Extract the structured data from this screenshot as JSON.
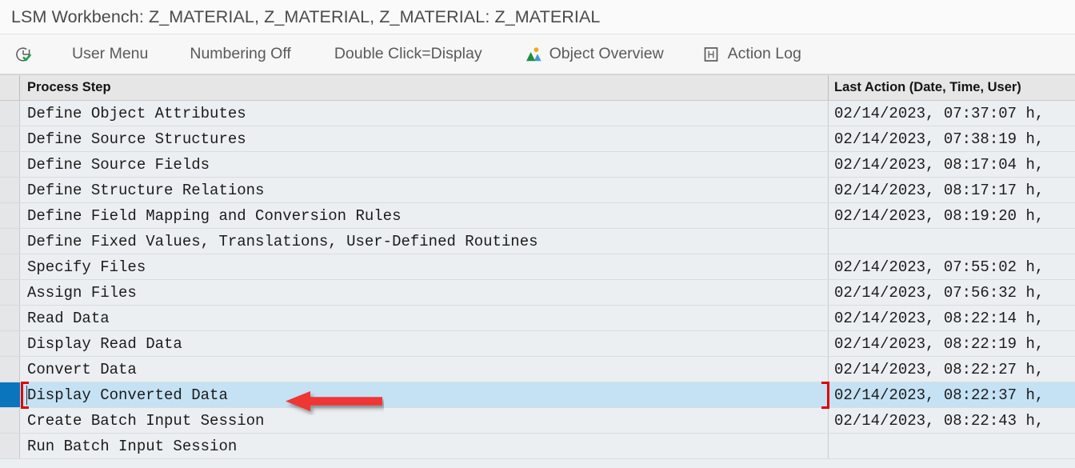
{
  "window": {
    "title": "LSM Workbench: Z_MATERIAL, Z_MATERIAL, Z_MATERIAL: Z_MATERIAL"
  },
  "toolbar": {
    "items": [
      {
        "label": "",
        "icon": "clock-check-icon"
      },
      {
        "label": "User Menu",
        "icon": ""
      },
      {
        "label": "Numbering Off",
        "icon": ""
      },
      {
        "label": "Double Click=Display",
        "icon": ""
      },
      {
        "label": "Object Overview",
        "icon": "image-overview-icon"
      },
      {
        "label": "Action Log",
        "icon": "h-box-icon"
      }
    ]
  },
  "grid": {
    "columns": [
      {
        "key": "step",
        "label": "Process Step"
      },
      {
        "key": "action",
        "label": "Last Action (Date, Time, User)"
      }
    ],
    "rows": [
      {
        "step": "Define Object Attributes",
        "action": "02/14/2023, 07:37:07 h,",
        "selected": false
      },
      {
        "step": "Define Source Structures",
        "action": "02/14/2023, 07:38:19 h,",
        "selected": false
      },
      {
        "step": "Define Source Fields",
        "action": "02/14/2023, 08:17:04 h,",
        "selected": false
      },
      {
        "step": "Define Structure Relations",
        "action": "02/14/2023, 08:17:17 h,",
        "selected": false
      },
      {
        "step": "Define Field Mapping and Conversion Rules",
        "action": "02/14/2023, 08:19:20 h,",
        "selected": false
      },
      {
        "step": "Define Fixed Values, Translations, User-Defined Routines",
        "action": "",
        "selected": false
      },
      {
        "step": "Specify Files",
        "action": "02/14/2023, 07:55:02 h,",
        "selected": false
      },
      {
        "step": "Assign Files",
        "action": "02/14/2023, 07:56:32 h,",
        "selected": false
      },
      {
        "step": "Read Data",
        "action": "02/14/2023, 08:22:14 h,",
        "selected": false
      },
      {
        "step": "Display Read Data",
        "action": "02/14/2023, 08:22:19 h,",
        "selected": false
      },
      {
        "step": "Convert Data",
        "action": "02/14/2023, 08:22:27 h,",
        "selected": false
      },
      {
        "step": "Display Converted Data",
        "action": "02/14/2023, 08:22:37 h,",
        "selected": true
      },
      {
        "step": "Create Batch Input Session",
        "action": "02/14/2023, 08:22:43 h,",
        "selected": false
      },
      {
        "step": "Run Batch Input Session",
        "action": "",
        "selected": false
      }
    ]
  },
  "annotation": {
    "arrow": "left-pointing-red-arrow",
    "color": "#f03434"
  },
  "colors": {
    "selected_row_bg": "#c5e2f5",
    "selected_gutter": "#0a74bd",
    "focus_bracket": "#e00000",
    "grid_bg": "#eceff1",
    "header_bg": "#e6e6e6"
  }
}
